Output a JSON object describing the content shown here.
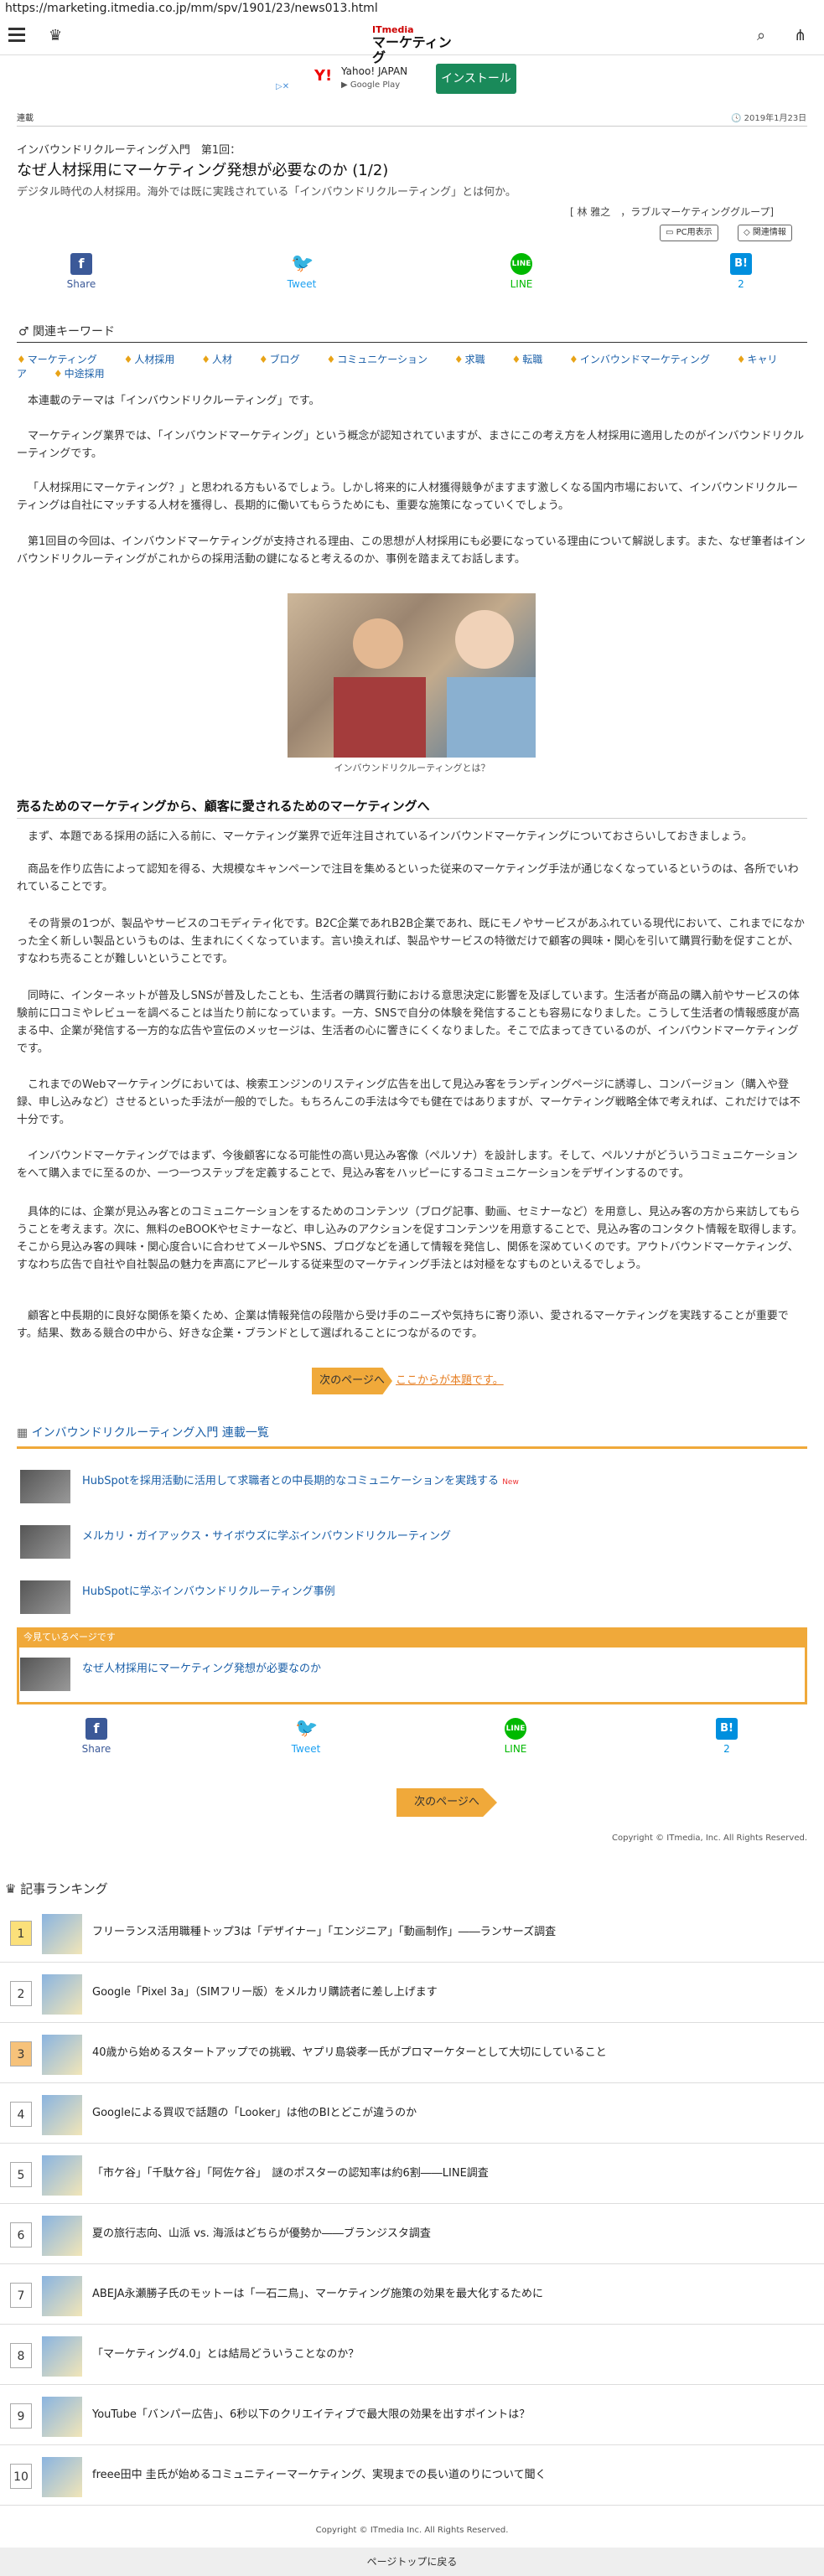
{
  "url": "https://marketing.itmedia.co.jp/mm/spv/1901/23/news013.html",
  "logo": {
    "top": "ITmedia",
    "bottom": "マーケティング"
  },
  "ad": {
    "brand": "Yahoo! JAPAN",
    "store": "Google Play",
    "button": "インストール"
  },
  "meta": {
    "category": "連載",
    "date": "2019年1月23日"
  },
  "article": {
    "series": "インバウンドリクルーティング入門　第1回：",
    "title": "なぜ人材採用にマーケティング発想が必要なのか (1/2)",
    "subtitle": "デジタル時代の人材採用。海外では既に実践されている「インバウンドリクルーティング」とは何か。",
    "author": "[ 林 雅之　，ラブルマーケティンググループ]",
    "pc_button": "PC用表示",
    "related_button": "関連情報"
  },
  "share": {
    "facebook": "Share",
    "twitter": "Tweet",
    "line": "LINE",
    "hatena_count": "2"
  },
  "keywords": {
    "title": "関連キーワード",
    "items": [
      "マーケティング",
      "人材採用",
      "人材",
      "ブログ",
      "コミュニケーション",
      "求職",
      "転職",
      "インバウンドマーケティング",
      "キャリア",
      "中途採用"
    ]
  },
  "body": {
    "p1": "本連載のテーマは「インバウンドリクルーティング」です。",
    "p2": "マーケティング業界では、「インバウンドマーケティング」という概念が認知されていますが、まさにこの考え方を人材採用に適用したのがインバウンドリクルーティングです。",
    "p3": "「人材採用にマーケティング？」と思われる方もいるでしょう。しかし将来的に人材獲得競争がますます激しくなる国内市場において、インバウンドリクルーティングは自社にマッチする人材を獲得し、長期的に働いてもらうためにも、重要な施策になっていくでしょう。",
    "p4": "第1回目の今回は、インバウンドマーケティングが支持される理由、この思想が人材採用にも必要になっている理由について解説します。また、なぜ筆者はインバウンドリクルーティングがこれからの採用活動の鍵になると考えるのか、事例を踏まえてお話します。",
    "caption": "インバウンドリクルーティングとは？",
    "h2": "売るためのマーケティングから、顧客に愛されるためのマーケティングへ",
    "p5": "まず、本題である採用の話に入る前に、マーケティング業界で近年注目されているインバウンドマーケティングについておさらいしておきましょう。",
    "p6": "商品を作り広告によって認知を得る、大規模なキャンペーンで注目を集めるといった従来のマーケティング手法が通じなくなっているというのは、各所でいわれていることです。",
    "p7": "その背景の1つが、製品やサービスのコモディティ化です。B2C企業であれB2B企業であれ、既にモノやサービスがあふれている現代において、これまでになかった全く新しい製品というものは、生まれにくくなっています。言い換えれば、製品やサービスの特徴だけで顧客の興味・関心を引いて購買行動を促すことが、すなわち売ることが難しいということです。",
    "p8": "同時に、インターネットが普及しSNSが普及したことも、生活者の購買行動における意思決定に影響を及ぼしています。生活者が商品の購入前やサービスの体験前に口コミやレビューを調べることは当たり前になっています。一方、SNSで自分の体験を発信することも容易になりました。こうして生活者の情報感度が高まる中、企業が発信する一方的な広告や宣伝のメッセージは、生活者の心に響きにくくなりました。そこで広まってきているのが、インバウンドマーケティングです。",
    "p9": "これまでのWebマーケティングにおいては、検索エンジンのリスティング広告を出して見込み客をランディングページに誘導し、コンバージョン（購入や登録、申し込みなど）させるといった手法が一般的でした。もちろんこの手法は今でも健在ではありますが、マーケティング戦略全体で考えれば、これだけでは不十分です。",
    "p10": "インバウンドマーケティングではまず、今後顧客になる可能性の高い見込み客像（ペルソナ）を設計します。そして、ペルソナがどういうコミュニケーションをへて購入までに至るのか、一つ一つステップを定義することで、見込み客をハッピーにするコミュニケーションをデザインするのです。",
    "p11": "具体的には、企業が見込み客とのコミュニケーションをするためのコンテンツ（ブログ記事、動画、セミナーなど）を用意し、見込み客の方から来訪してもらうことを考えます。次に、無料のeBOOKやセミナーなど、申し込みのアクションを促すコンテンツを用意することで、見込み客のコンタクト情報を取得します。そこから見込み客の興味・関心度合いに合わせてメールやSNS、ブログなどを通して情報を発信し、関係を深めていくのです。アウトバウンドマーケティング、すなわち広告で自社や自社製品の魅力を声高にアピールする従来型のマーケティング手法とは対極をなすものといえるでしょう。",
    "p12": "顧客と中長期的に良好な関係を築くため、企業は情報発信の段階から受け手のニーズや気持ちに寄り添い、愛されるマーケティングを実践することが重要です。結果、数ある競合の中から、好きな企業・ブランドとして選ばれることにつながるのです。"
  },
  "next": {
    "label": "次のページへ",
    "link": "ここからが本題です。"
  },
  "series_list": {
    "title": "インバウンドリクルーティング入門 連載一覧",
    "items": [
      {
        "title": "HubSpotを採用活動に活用して求職者との中長期的なコミュニケーションを実践する",
        "badge": "New"
      },
      {
        "title": "メルカリ・ガイアックス・サイボウズに学ぶインバウンドリクルーティング"
      },
      {
        "title": "HubSpotに学ぶインバウンドリクルーティング事例"
      }
    ],
    "current_label": "今見ているページです",
    "current_title": "なぜ人材採用にマーケティング発想が必要なのか"
  },
  "next2": "次のページへ",
  "copyright": "Copyright © ITmedia, Inc. All Rights Reserved.",
  "ranking": {
    "title": "記事ランキング",
    "items": [
      "フリーランス活用職種トップ3は「デザイナー」「エンジニア」「動画制作」――ランサーズ調査",
      "Google「Pixel 3a」（SIMフリー版）をメルカリ購読者に差し上げます",
      "40歳から始めるスタートアップでの挑戦、ヤプリ島袋孝一氏がプロマーケターとして大切にしていること",
      "Googleによる買収で話題の「Looker」は他のBIとどこが違うのか",
      "「市ケ谷」「千駄ケ谷」「阿佐ケ谷」　謎のポスターの認知率は約6割――LINE調査",
      "夏の旅行志向、山派 vs. 海派はどちらが優勢か――ブランジスタ調査",
      "ABEJA永瀬勝子氏のモットーは「一石二鳥」、マーケティング施策の効果を最大化するために",
      "「マーケティング4.0」とは結局どういうことなのか？",
      "YouTube「バンパー広告」、6秒以下のクリエイティブで最大限の効果を出すポイントは？",
      "freee田中 圭氏が始めるコミュニティーマーケティング、実現までの長い道のりについて聞く"
    ]
  },
  "copyright2": "Copyright © ITmedia Inc. All Rights Reserved.",
  "pagetop": "ページトップに戻る",
  "colors": {
    "accent": "#f0a93a",
    "link": "#1a5fa8",
    "facebook": "#3b5998",
    "twitter": "#1da1f2",
    "line": "#00b900",
    "hatena": "#008fde"
  }
}
